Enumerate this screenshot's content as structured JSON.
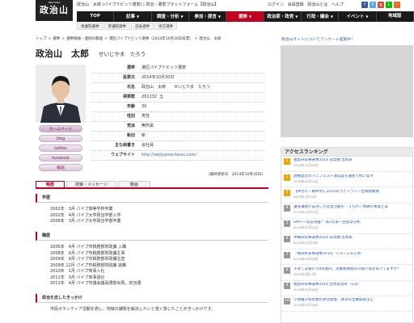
{
  "header": {
    "logo_text": "政治山",
    "logo_sub": "SEIJIYAMA",
    "site_desc": "政治山　太郎 (パイプドビッツ選挙) | 政治・選挙プラットフォーム【政治山】",
    "util_links": [
      "ログイン",
      "会員登録",
      "政治山とは",
      "ヘルプ"
    ],
    "social_colors": [
      "#3b5998",
      "#55acee",
      "#dd4b39",
      "#00c300",
      "#f26522"
    ],
    "nav_items": [
      {
        "label": "TOP",
        "arrow": ""
      },
      {
        "label": "記事",
        "arrow": "▼"
      },
      {
        "label": "調査・分析",
        "arrow": "▼"
      },
      {
        "label": "参加・提言",
        "arrow": "▼"
      },
      {
        "label": "選挙",
        "arrow": "▼"
      },
      {
        "label": "政治家・政党",
        "arrow": "▼"
      },
      {
        "label": "行政・議会",
        "arrow": "▼"
      },
      {
        "label": "イベント",
        "arrow": "▼"
      },
      {
        "label": "地域版",
        "arrow": ""
      }
    ],
    "sub_nav": [
      "衆議院選挙",
      "参議院選挙",
      "首長選挙",
      "地方選挙"
    ]
  },
  "breadcrumb": [
    "トップ",
    ">",
    "選挙",
    ">",
    "選挙情報・連続の無理",
    ">",
    "港区パイプドビッツ選挙（2014年10月30日投票）",
    ">",
    "政治山　太郎"
  ],
  "candidate": {
    "name": "政治山　太郎",
    "kana": "せいじやま　たろう",
    "buttons": [
      "ホームページ",
      "blog",
      "twitter",
      "facebook",
      "動画"
    ]
  },
  "info_rows": [
    {
      "key": "選挙",
      "value": "港区パイプドビッツ選挙",
      "tag": ""
    },
    {
      "key": "投票日",
      "value": "2014年10月30日",
      "tag": ""
    },
    {
      "key": "氏名",
      "value": "政治山　太郎　　せいじやま　たろう",
      "tag": ""
    },
    {
      "key": "得票数",
      "value": "201132",
      "tag": "当"
    },
    {
      "key": "年齢",
      "value": "30",
      "tag": ""
    },
    {
      "key": "性別",
      "value": "男性",
      "tag": ""
    },
    {
      "key": "党派",
      "value": "無所属",
      "tag": ""
    },
    {
      "key": "新旧",
      "value": "新",
      "tag": ""
    },
    {
      "key": "主な肩書き",
      "value": "会社員",
      "tag": ""
    },
    {
      "key": "ウェブサイト",
      "value": "http://seijiyama-tarou.com/",
      "tag": ""
    }
  ],
  "updated": "(最終更新日　2014年10月30日)",
  "tabs": [
    "略歴",
    "政策・メッセージ",
    "動画"
  ],
  "sections": {
    "education_title": "学歴",
    "education": [
      "2002年　3月 パイプ高等学校卒業",
      "2002年　4月 パイプ大学政治学部入学",
      "2006年　3月 パイプ大学政治学部卒業"
    ],
    "career_title": "職歴",
    "career": [
      "2006年　4月 パイプ市税務部財政課 入職",
      "2008年　6月 パイプ市税務部財政課主事",
      "2009年　9月 パイプ市税務部財政課主査",
      "2009年 12月 パイプ市税務部財政課 退職",
      "2010年　1月 パイプ商事入社",
      "2011年　3月 パイプ商事退社",
      "2011年　4月 パイプ市議会議員選挙出馬、初当選"
    ],
    "motive_title": "政治を志したきっかけ",
    "motive": "市民ボランティア活動を通し、地域の課題を解決したいと強く感じたことがきっかけです。"
  },
  "sidebar": {
    "survey_link": "政治山サイトについてアンケート実施中！",
    "ranking_title": "アクセスランキング",
    "ranking": [
      {
        "num": "1",
        "title": "福島県知事選挙2014 得票数 出馬表",
        "date": "2014年10月26日"
      },
      {
        "num": "2",
        "title": "政権発足のマニフェスト達成度を議会で問い質す",
        "date": "2014年10月24日"
      },
      {
        "num": "3",
        "title": "【神奈川・藤井市】2014あつぎマラソン出場者概要",
        "date": "2014年7月31日"
      },
      {
        "num": "4",
        "title": "議会議員が成功した社会活動の「うちわ」問題の本質とは",
        "date": "2014年10月23日"
      },
      {
        "num": "5",
        "title": "SMパーは支持層？ 第2次第一回投票分析",
        "date": "2014年10月22日"
      },
      {
        "num": "6",
        "title": "沖縄県知事選挙2014 得票数 出馬表",
        "date": "2014年10月28日"
      },
      {
        "num": "7",
        "title": "「福岡県知事選挙2014」ニュースまとめ",
        "date": "2014年10月18日"
      },
      {
        "num": "8",
        "title": "子育て支援に7000億円、消費税増税分の使い道を知ってますか？",
        "date": "2014年5月13日"
      },
      {
        "num": "9",
        "title": "福島県知事選挙2014 出馬投票率（1/4）",
        "date": "2014年10月18日"
      },
      {
        "num": "10",
        "title": "小渕優子経産相の政治資金、異常な出費疑惑浮上",
        "date": "2014年10月16日"
      }
    ]
  }
}
